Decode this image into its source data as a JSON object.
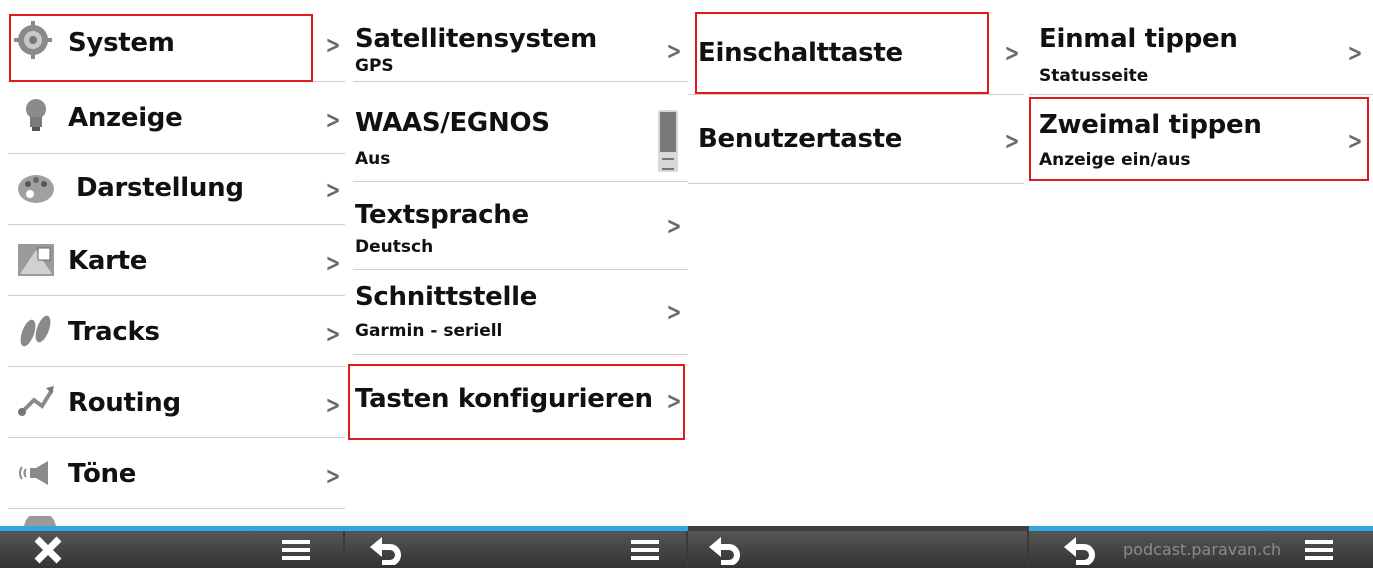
{
  "panel1": {
    "items": [
      {
        "label": "System",
        "icon": "gear-icon"
      },
      {
        "label": "Anzeige",
        "icon": "lightbulb-icon"
      },
      {
        "label": "Darstellung",
        "icon": "palette-icon"
      },
      {
        "label": "Karte",
        "icon": "map-icon"
      },
      {
        "label": "Tracks",
        "icon": "footprints-icon"
      },
      {
        "label": "Routing",
        "icon": "route-icon"
      },
      {
        "label": "Töne",
        "icon": "speaker-icon"
      }
    ]
  },
  "panel2": {
    "items": [
      {
        "label": "Satellitensystem",
        "value": "GPS"
      },
      {
        "label": "WAAS/EGNOS",
        "value": "Aus"
      },
      {
        "label": "Textsprache",
        "value": "Deutsch"
      },
      {
        "label": "Schnittstelle",
        "value": "Garmin - seriell"
      },
      {
        "label": "Tasten konfigurieren"
      }
    ]
  },
  "panel3": {
    "items": [
      {
        "label": "Einschalttaste"
      },
      {
        "label": "Benutzertaste"
      }
    ]
  },
  "panel4": {
    "items": [
      {
        "label": "Einmal tippen",
        "value": "Statusseite"
      },
      {
        "label": "Zweimal tippen",
        "value": "Anzeige ein/aus"
      }
    ]
  },
  "chevron": ">",
  "watermark": "podcast.paravan.ch",
  "colors": {
    "highlight": "#e01a1a",
    "accent": "#2fa8e0",
    "bar": "#444444"
  },
  "bottom_icons": [
    "close-icon",
    "menu-icon",
    "back-icon"
  ]
}
